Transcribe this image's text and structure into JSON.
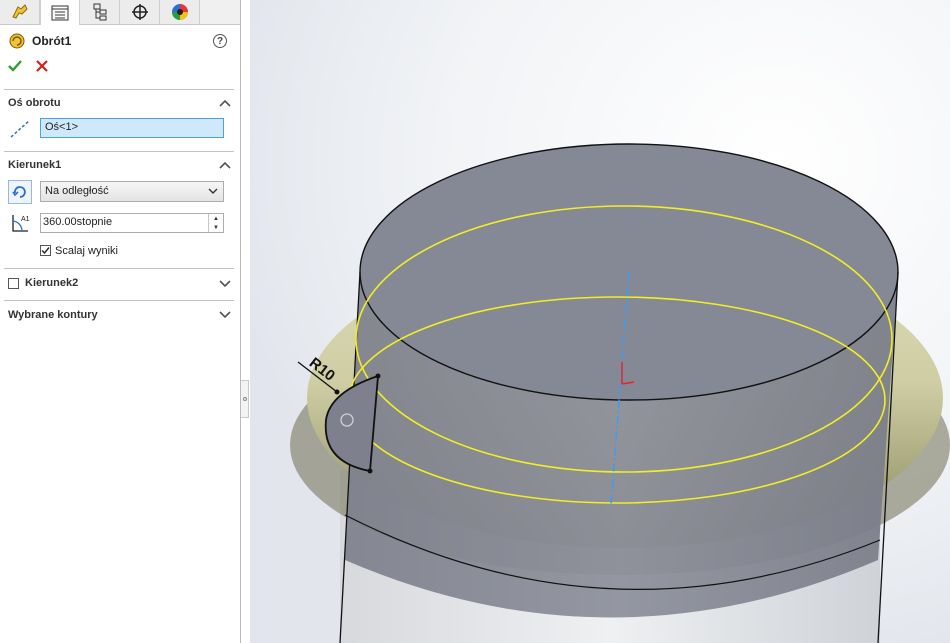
{
  "tabs": [
    {
      "icon": "feature-manager-icon"
    },
    {
      "icon": "property-manager-icon"
    },
    {
      "icon": "configuration-manager-icon"
    },
    {
      "icon": "dimxpert-icon"
    },
    {
      "icon": "display-manager-icon"
    }
  ],
  "feature": {
    "title": "Obrót1",
    "help": "?"
  },
  "axis_section": {
    "title": "Oś obrotu",
    "value": "Oś<1>"
  },
  "direction1": {
    "title": "Kierunek1",
    "type": "Na odległość",
    "angle": "360.00stopnie",
    "merge_label": "Scalaj wyniki",
    "merge_checked": true
  },
  "direction2": {
    "title": "Kierunek2",
    "checked": false
  },
  "contours": {
    "title": "Wybrane kontury"
  },
  "viewport": {
    "dimension_label": "R10"
  },
  "colors": {
    "accent_blue": "#4aa3df",
    "highlight_yellow": "#f2ee25",
    "body_gray": "#8a8d99",
    "torus": "#cfcfa6"
  }
}
